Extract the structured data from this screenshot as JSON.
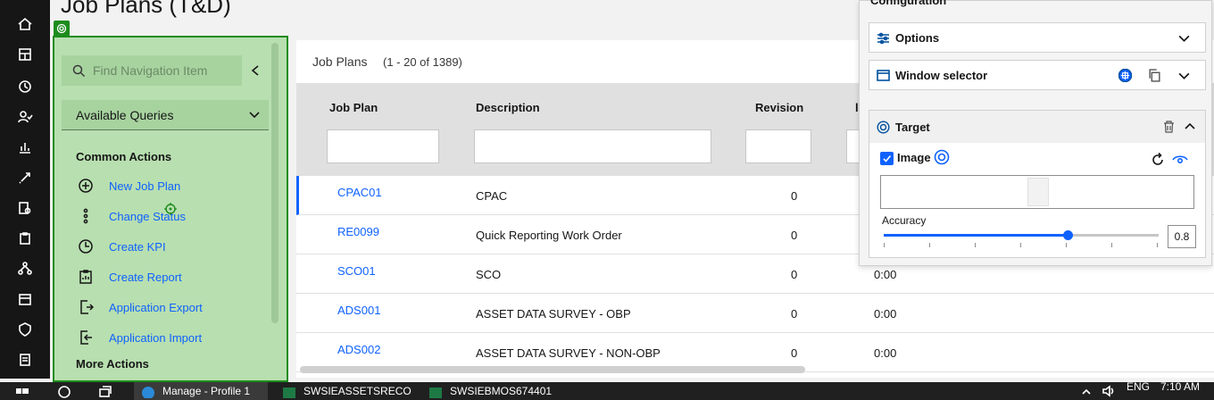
{
  "page": {
    "title": "Job Plans (T&D)"
  },
  "rail": {
    "items": [
      "home-icon",
      "dashboard-icon",
      "history-icon",
      "user-check-icon",
      "chart-icon",
      "rocket-icon",
      "search-doc-icon",
      "clipboard-icon",
      "network-icon",
      "calendar-icon",
      "shield-icon",
      "receipt-icon"
    ]
  },
  "navigator": {
    "search_placeholder": "Find Navigation Item",
    "available_queries": "Available Queries",
    "common_actions": "Common Actions",
    "actions": [
      {
        "label": "New Job Plan",
        "icon": "add-circle-icon"
      },
      {
        "label": "Change Status",
        "icon": "dots-vertical-icon"
      },
      {
        "label": "Create KPI",
        "icon": "clock-icon"
      },
      {
        "label": "Create Report",
        "icon": "clipboard-report-icon"
      },
      {
        "label": "Application Export",
        "icon": "export-icon"
      },
      {
        "label": "Application Import",
        "icon": "import-icon"
      }
    ],
    "more_actions": "More Actions"
  },
  "table": {
    "title": "Job Plans",
    "count": "(1 - 20 of 1389)",
    "columns": [
      "Job Plan",
      "Description",
      "Revision"
    ],
    "rows": [
      {
        "job_plan": "CPAC01",
        "description": "CPAC",
        "revision": "0",
        "extra": ""
      },
      {
        "job_plan": "RE0099",
        "description": "Quick Reporting Work Order",
        "revision": "0",
        "extra": ""
      },
      {
        "job_plan": "SCO01",
        "description": "SCO",
        "revision": "0",
        "extra": "0:00"
      },
      {
        "job_plan": "ADS001",
        "description": "ASSET DATA SURVEY - OBP",
        "revision": "0",
        "extra": "0:00"
      },
      {
        "job_plan": "ADS002",
        "description": "ASSET DATA SURVEY - NON-OBP",
        "revision": "0",
        "extra": "0:00"
      }
    ]
  },
  "config": {
    "title": "Configuration",
    "options_label": "Options",
    "window_selector_label": "Window selector",
    "target_label": "Target",
    "image_label": "Image",
    "image_checked": true,
    "accuracy_label": "Accuracy",
    "accuracy_value": "0.8",
    "accuracy_fraction": 0.67
  },
  "taskbar": {
    "items": [
      {
        "label": "Manage - Profile 1",
        "active": true
      },
      {
        "label": "SWSIEASSETSRECO"
      },
      {
        "label": "SWSIEBMOS674401"
      }
    ],
    "language": "ENG",
    "time": "7:10 AM"
  }
}
